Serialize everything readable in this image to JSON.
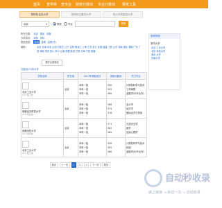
{
  "nav": {
    "items": [
      "首页",
      "查学校",
      "查专业",
      "院校分数线",
      "专业分数线",
      "报考工具"
    ]
  },
  "tabs": [
    "按院校名查大学",
    "按院校位置查大学",
    "按大学类型查大学"
  ],
  "search": {
    "select_value": "北京",
    "radio1": "院校",
    "radio2": "专业",
    "button": "搜索"
  },
  "filters": {
    "area_label": "所在位置:",
    "area_values": [
      "北京",
      "湖北",
      "河南"
    ],
    "level_label": "办学层次:",
    "level_values": [
      "本科",
      "专科"
    ],
    "type_label": "院校类型:",
    "type_values": [
      "本科",
      "高职",
      "高职(专)"
    ],
    "province_label": "省份:",
    "provinces": "北京 天津 河北 山西 内蒙古 辽宁 吉林 黑龙江 上海 江苏 浙江 安徽 福建 江西 山东 河南 湖北 湖南 广东 广西 海南 重庆 四川 贵州 云南 西藏 陕西 甘肃 青海 宁夏 新疆",
    "options_button": "展开全部筛选"
  },
  "result_count": "共找到(15)所大学",
  "table": {
    "headers": [
      "学校名称",
      "所在地",
      "2017年录取批次",
      "录取分数线",
      "热门专业"
    ],
    "rows": [
      {
        "name": "北京工业大学",
        "sub": "211 理工类",
        "loc": "北京",
        "batch": [
          "本科一批",
          "本科一批",
          "本科一批"
        ],
        "score": [
          "590",
          "592",
          "580"
        ],
        "majors": [
          "计算机科学与技术",
          "工商管理",
          "金融学(中外合作)"
        ]
      },
      {
        "name": "首都经济贸易大学",
        "sub": "211 财经类",
        "loc": "北京",
        "batch": [
          "本科一批",
          "本科一批",
          "本科一批"
        ],
        "score": [
          "588",
          "574",
          "576"
        ],
        "majors": [
          "会计学",
          "经济学",
          "国际经济与贸易"
        ]
      },
      {
        "name": "首都师范大学",
        "sub": "211 师范类",
        "loc": "北京",
        "batch": [
          "本科一批",
          "本科一批",
          "本科一批"
        ],
        "score": [
          "571",
          "562",
          "565"
        ],
        "majors": [
          "汉语言文学",
          "数学",
          "应用心理学"
        ]
      },
      {
        "name": "北京工业大学",
        "sub": "211 理工类",
        "loc": "北京",
        "batch": [
          "本科一批",
          "本科一批",
          "本科一批"
        ],
        "score": [
          "590",
          "592",
          "580"
        ],
        "majors": [
          "计算机科学与技术",
          "机械",
          "金融学(中外合作)"
        ]
      }
    ]
  },
  "pager": {
    "first": "首页",
    "prev": "上一页",
    "pages": [
      "1",
      "2",
      "3"
    ],
    "next": "下一页",
    "last": "尾页"
  },
  "side": {
    "head": "推荐院校",
    "title": "清华大学",
    "items": [
      "北京 工业大学",
      "北京 师范大学",
      "湖北 大学",
      "河南大学"
    ]
  },
  "watermark": {
    "title": "自动秒收录",
    "sub": "做上链接 → 来访一次 → 自动收录"
  }
}
